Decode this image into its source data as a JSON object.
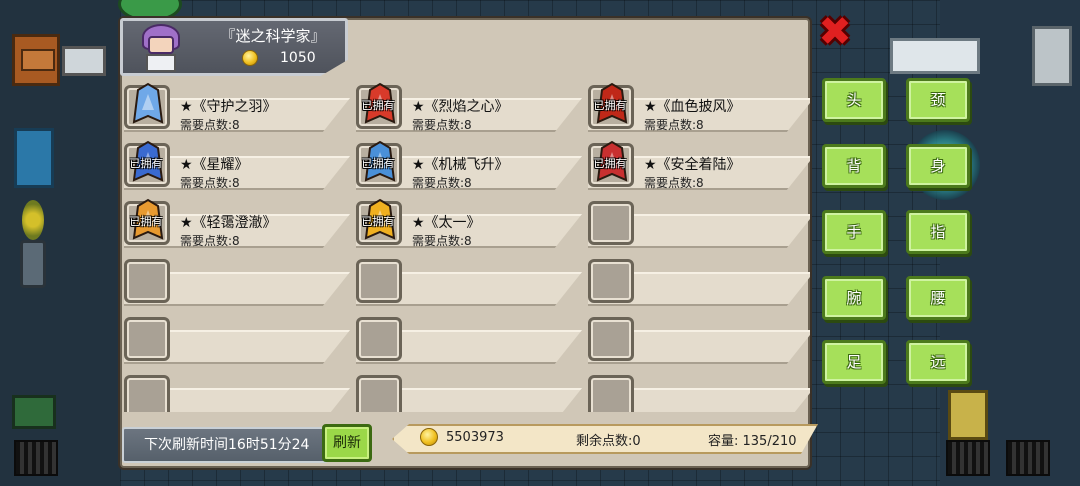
{
  "merchant": {
    "name": "『迷之科学家』",
    "gold": "1050"
  },
  "items": [
    {
      "name": "★《守护之羽》",
      "cost": "需要点数:8",
      "owned": "",
      "icon": "wing-feather-icon",
      "color": "#6fa8e8"
    },
    {
      "name": "★《烈焰之心》",
      "cost": "需要点数:8",
      "owned": "已拥有",
      "icon": "flame-heart-icon",
      "color": "#d83a2a"
    },
    {
      "name": "★《血色披风》",
      "cost": "需要点数:8",
      "owned": "已拥有",
      "icon": "blood-cape-icon",
      "color": "#c02818"
    },
    {
      "name": "★《星耀》",
      "cost": "需要点数:8",
      "owned": "已拥有",
      "icon": "star-armor-icon",
      "color": "#3a6ad0"
    },
    {
      "name": "★《机械飞升》",
      "cost": "需要点数:8",
      "owned": "已拥有",
      "icon": "mech-wings-icon",
      "color": "#4a90d8"
    },
    {
      "name": "★《安全着陆》",
      "cost": "需要点数:8",
      "owned": "已拥有",
      "icon": "landing-gear-icon",
      "color": "#c83030"
    },
    {
      "name": "★《轻霭澄澈》",
      "cost": "需要点数:8",
      "owned": "已拥有",
      "icon": "mist-cape-icon",
      "color": "#e89a30"
    },
    {
      "name": "★《太一》",
      "cost": "需要点数:8",
      "owned": "已拥有",
      "icon": "golden-wing-icon",
      "color": "#f0b020"
    },
    {
      "name": "",
      "cost": "",
      "owned": "",
      "icon": "",
      "color": ""
    },
    {
      "name": "",
      "cost": "",
      "owned": "",
      "icon": "",
      "color": ""
    },
    {
      "name": "",
      "cost": "",
      "owned": "",
      "icon": "",
      "color": ""
    },
    {
      "name": "",
      "cost": "",
      "owned": "",
      "icon": "",
      "color": ""
    },
    {
      "name": "",
      "cost": "",
      "owned": "",
      "icon": "",
      "color": ""
    },
    {
      "name": "",
      "cost": "",
      "owned": "",
      "icon": "",
      "color": ""
    },
    {
      "name": "",
      "cost": "",
      "owned": "",
      "icon": "",
      "color": ""
    },
    {
      "name": "",
      "cost": "",
      "owned": "",
      "icon": "",
      "color": ""
    },
    {
      "name": "",
      "cost": "",
      "owned": "",
      "icon": "",
      "color": ""
    },
    {
      "name": "",
      "cost": "",
      "owned": "",
      "icon": "",
      "color": ""
    }
  ],
  "footer": {
    "refresh_timer": "下次刷新时间16时51分24",
    "refresh_button": "刷新",
    "player_gold": "5503973",
    "remaining_points": "剩余点数:0",
    "capacity": "容量: 135/210"
  },
  "categories": [
    "头",
    "颈",
    "背",
    "身",
    "手",
    "指",
    "腕",
    "腰",
    "足",
    "远"
  ],
  "close_icon": "close-x-icon",
  "colors": {
    "panel": "#d0c7b7",
    "category_button": "#a6e05a",
    "close": "#e02020"
  }
}
